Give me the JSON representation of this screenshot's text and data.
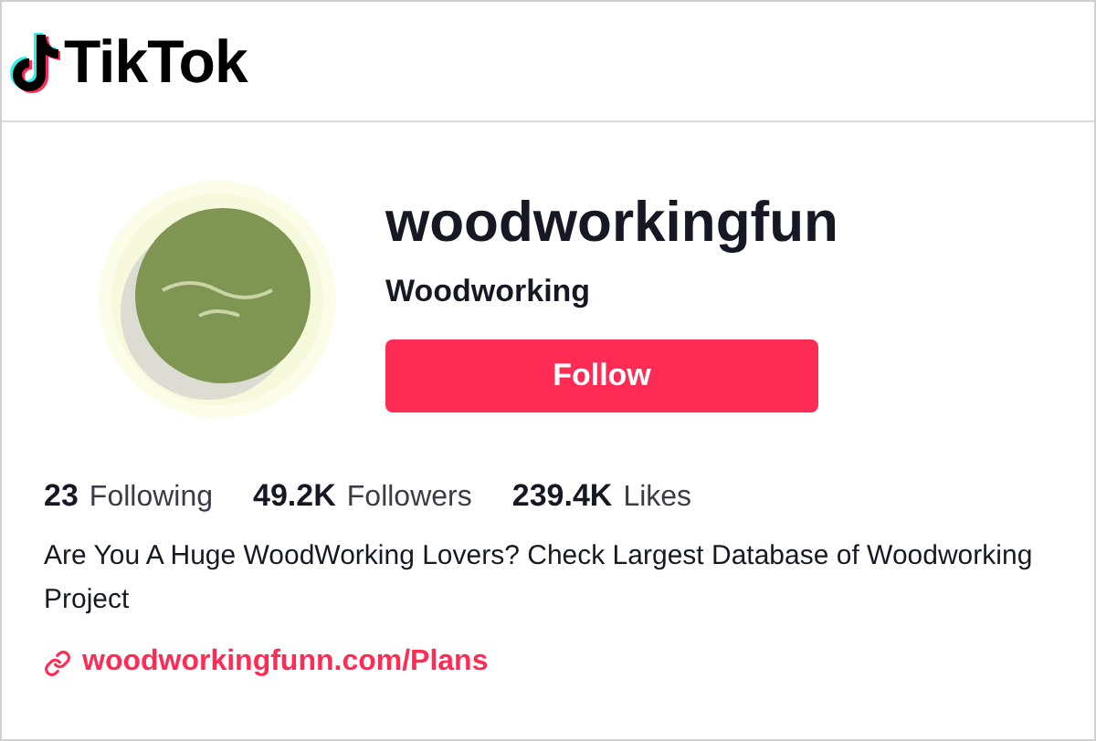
{
  "header": {
    "logo_text": "TikTok"
  },
  "profile": {
    "username": "woodworkingfun",
    "display_name": "Woodworking",
    "follow_button": "Follow"
  },
  "stats": [
    {
      "count": "23",
      "label": "Following"
    },
    {
      "count": "49.2K",
      "label": "Followers"
    },
    {
      "count": "239.4K",
      "label": "Likes"
    }
  ],
  "bio": "Are You A Huge WoodWorking Lovers? Check Largest Database of Woodworking Project",
  "link": "woodworkingfunn.com/Plans"
}
